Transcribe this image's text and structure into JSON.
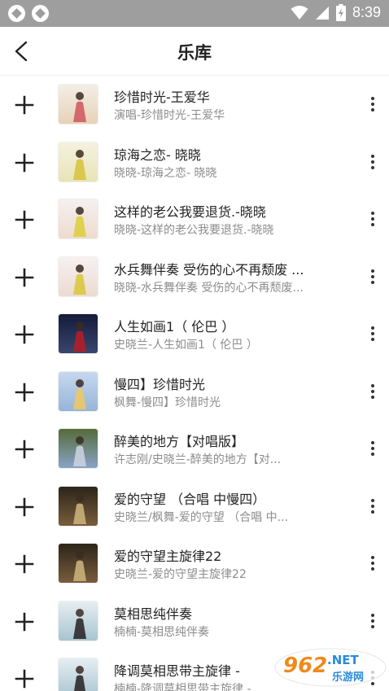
{
  "status_bar": {
    "time": "8:39",
    "icons": [
      "vpn-icon",
      "vpn-icon",
      "wifi-icon",
      "cell-signal-icon",
      "battery-charging-icon"
    ]
  },
  "header": {
    "title": "乐库",
    "back_icon": "chevron-left-icon"
  },
  "songs": [
    {
      "title": "珍惜时光-王爱华",
      "subtitle": "演唱-珍惜时光-王爱华",
      "cover_colors": [
        "#f3eee6",
        "#e7d2b7",
        "#cf5c64"
      ]
    },
    {
      "title": "琼海之恋- 晓晓",
      "subtitle": "晓晓-琼海之恋- 晓晓",
      "cover_colors": [
        "#f4f1e0",
        "#e9e4b5",
        "#d7c440"
      ]
    },
    {
      "title": "这样的老公我要退货.-晓晓",
      "subtitle": "晓晓-这样的老公我要退货.-晓晓",
      "cover_colors": [
        "#f6f0f1",
        "#eddccc",
        "#dccf40"
      ]
    },
    {
      "title": "水兵舞伴奏 受伤的心不再颓废 ...",
      "subtitle": "晓晓-水兵舞伴奏 受伤的心不再颓废...",
      "cover_colors": [
        "#f7f1f1",
        "#ebdbd0",
        "#d8c83f"
      ]
    },
    {
      "title": "人生如画1（ 伦巴 ）",
      "subtitle": "史晓兰-人生如画1（ 伦巴 ）",
      "cover_colors": [
        "#141b3a",
        "#39466e",
        "#b21e2a"
      ]
    },
    {
      "title": "慢四】珍惜时光",
      "subtitle": "枫舞-慢四】珍惜时光",
      "cover_colors": [
        "#c7d8ee",
        "#96b4d9",
        "#eac867"
      ]
    },
    {
      "title": "醉美的地方【对唱版】",
      "subtitle": "许志刚/史晓兰-醉美的地方【对...",
      "cover_colors": [
        "#546b3a",
        "#8aa3c8",
        "#c7d2de"
      ]
    },
    {
      "title": "爱的守望 （合唱 中慢四）",
      "subtitle": "史晓兰/枫舞-爱的守望 （合唱 中...",
      "cover_colors": [
        "#2b2519",
        "#7a5d3c",
        "#c9b07a"
      ]
    },
    {
      "title": "爱的守望主旋律22",
      "subtitle": "史晓兰-爱的守望主旋律22",
      "cover_colors": [
        "#2b2519",
        "#7a5d3c",
        "#c9b07a"
      ]
    },
    {
      "title": "莫相思纯伴奏",
      "subtitle": "楠楠-莫相思纯伴奏",
      "cover_colors": [
        "#e6eef2",
        "#a7c4cf",
        "#2f2a2a"
      ]
    },
    {
      "title": "降调莫相思带主旋律 -",
      "subtitle": "楠楠-降调莫相思带主旋律 -",
      "cover_colors": [
        "#e6eef2",
        "#a7c4cf",
        "#2f2a2a"
      ]
    }
  ],
  "watermark": {
    "brand": "962",
    "domain": ".NET",
    "tagline": "乐游网"
  }
}
